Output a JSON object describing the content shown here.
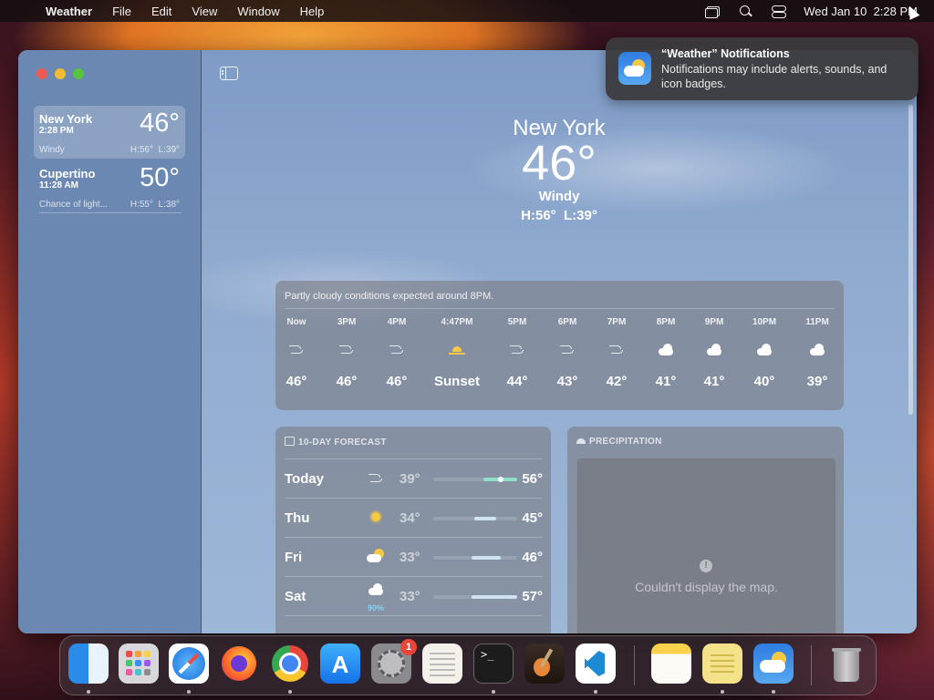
{
  "menubar": {
    "app": "Weather",
    "items": [
      "File",
      "Edit",
      "View",
      "Window",
      "Help"
    ],
    "datetime": "Wed Jan 10  2:28 PM"
  },
  "notification": {
    "title": "“Weather” Notifications",
    "body": "Notifications may include alerts, sounds, and icon badges."
  },
  "sidebar": {
    "locations": [
      {
        "city": "New York",
        "time": "2:28 PM",
        "temp": "46°",
        "condition": "Windy",
        "hilo": "H:56°  L:39°"
      },
      {
        "city": "Cupertino",
        "time": "11:28 AM",
        "temp": "50°",
        "condition": "Chance of light...",
        "hilo": "H:55°  L:38°"
      }
    ]
  },
  "hero": {
    "city": "New York",
    "temp": "46°",
    "condition": "Windy",
    "hilo": "H:56°  L:39°"
  },
  "hourly": {
    "note": "Partly cloudy conditions expected around 8PM.",
    "items": [
      {
        "time": "Now",
        "icon": "wind-icon",
        "value": "46°"
      },
      {
        "time": "3PM",
        "icon": "wind-icon",
        "value": "46°"
      },
      {
        "time": "4PM",
        "icon": "wind-icon",
        "value": "46°"
      },
      {
        "time": "4:47PM",
        "icon": "sunset-icon",
        "value": "Sunset"
      },
      {
        "time": "5PM",
        "icon": "wind-icon",
        "value": "44°"
      },
      {
        "time": "6PM",
        "icon": "wind-icon",
        "value": "43°"
      },
      {
        "time": "7PM",
        "icon": "wind-icon",
        "value": "42°"
      },
      {
        "time": "8PM",
        "icon": "cloud-moon-icon",
        "value": "41°"
      },
      {
        "time": "9PM",
        "icon": "cloud-moon-icon",
        "value": "41°"
      },
      {
        "time": "10PM",
        "icon": "cloud-moon-icon",
        "value": "40°"
      },
      {
        "time": "11PM",
        "icon": "cloud-moon-icon",
        "value": "39°"
      }
    ]
  },
  "tenday": {
    "header": "10-DAY FORECAST",
    "days": [
      {
        "day": "Today",
        "icon": "wind-icon",
        "pop": "",
        "low": "39°",
        "high": "56°"
      },
      {
        "day": "Thu",
        "icon": "sun-icon",
        "pop": "",
        "low": "34°",
        "high": "45°"
      },
      {
        "day": "Fri",
        "icon": "partly-sunny-icon",
        "pop": "",
        "low": "33°",
        "high": "46°"
      },
      {
        "day": "Sat",
        "icon": "rain-cloud-icon",
        "pop": "90%",
        "low": "33°",
        "high": "57°"
      }
    ]
  },
  "precipitation": {
    "header": "PRECIPITATION",
    "message": "Couldn't display the map."
  },
  "dock": {
    "apps": [
      "finder-icon",
      "launchpad-icon",
      "safari-icon",
      "firefox-icon",
      "chrome-icon",
      "app-store-icon",
      "system-settings-icon",
      "textedit-icon",
      "terminal-icon",
      "garageband-icon",
      "vscode-icon",
      "notes-icon",
      "stickies-icon",
      "weather-icon",
      "trash-icon"
    ],
    "settings_badge": "1"
  }
}
